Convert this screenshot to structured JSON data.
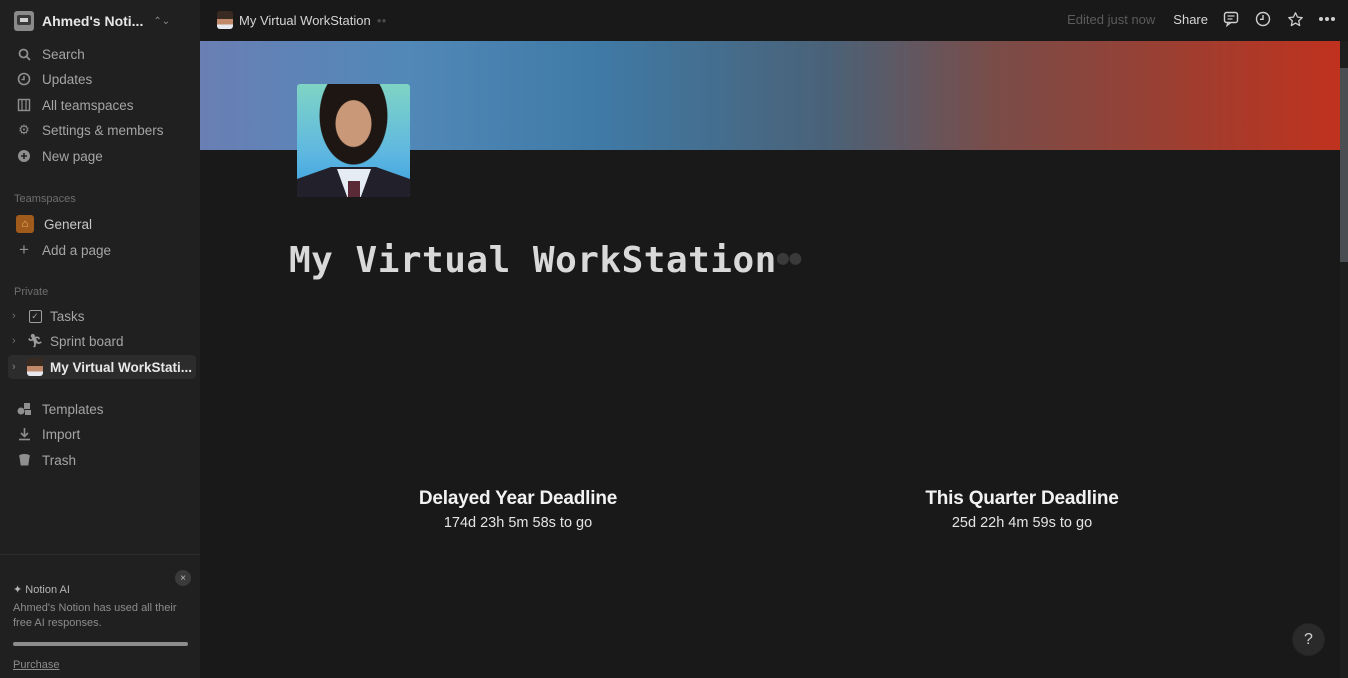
{
  "workspace": {
    "name": "Ahmed's Noti...",
    "switcher_icon": "chevron-up-down-icon"
  },
  "sidebar": {
    "nav": [
      {
        "label": "Search",
        "icon": "search-icon"
      },
      {
        "label": "Updates",
        "icon": "clock-icon"
      },
      {
        "label": "All teamspaces",
        "icon": "building-icon"
      },
      {
        "label": "Settings & members",
        "icon": "gear-icon"
      },
      {
        "label": "New page",
        "icon": "plus-circle-icon"
      }
    ],
    "teamspaces_label": "Teamspaces",
    "teamspaces": [
      {
        "label": "General",
        "icon": "home-icon"
      },
      {
        "label": "Add a page",
        "icon": "plus-icon"
      }
    ],
    "private_label": "Private",
    "private": [
      {
        "label": "Tasks",
        "icon": "checkbox-icon"
      },
      {
        "label": "Sprint board",
        "icon": "running-icon"
      },
      {
        "label": "My Virtual WorkStati...",
        "icon": "avatar-icon",
        "active": true
      }
    ],
    "bottom": [
      {
        "label": "Templates",
        "icon": "templates-icon"
      },
      {
        "label": "Import",
        "icon": "download-icon"
      },
      {
        "label": "Trash",
        "icon": "trash-icon"
      }
    ],
    "ai_panel": {
      "title": "Notion AI",
      "message": "Ahmed's Notion has used all their free AI responses.",
      "usage_percent": 100,
      "purchase_label": "Purchase",
      "close_label": "×"
    }
  },
  "topbar": {
    "breadcrumb": "My Virtual WorkStation",
    "edited": "Edited just now",
    "share_label": "Share",
    "icons": [
      "comment-icon",
      "history-icon",
      "star-icon",
      "more-icon"
    ]
  },
  "page": {
    "title": "My Virtual WorkStation",
    "title_emoji": "🕶",
    "countdowns": [
      {
        "title": "Delayed Year Deadline",
        "time": "174d 23h 5m 58s to go"
      },
      {
        "title": "This Quarter Deadline",
        "time": "25d 22h 4m 59s to go"
      }
    ]
  },
  "help_label": "?",
  "colors": {
    "background": "#191919",
    "sidebar": "#202020",
    "cover_start": "#6a7fb4",
    "cover_mid": "#3f7aa6",
    "cover_end": "#c0321e"
  }
}
